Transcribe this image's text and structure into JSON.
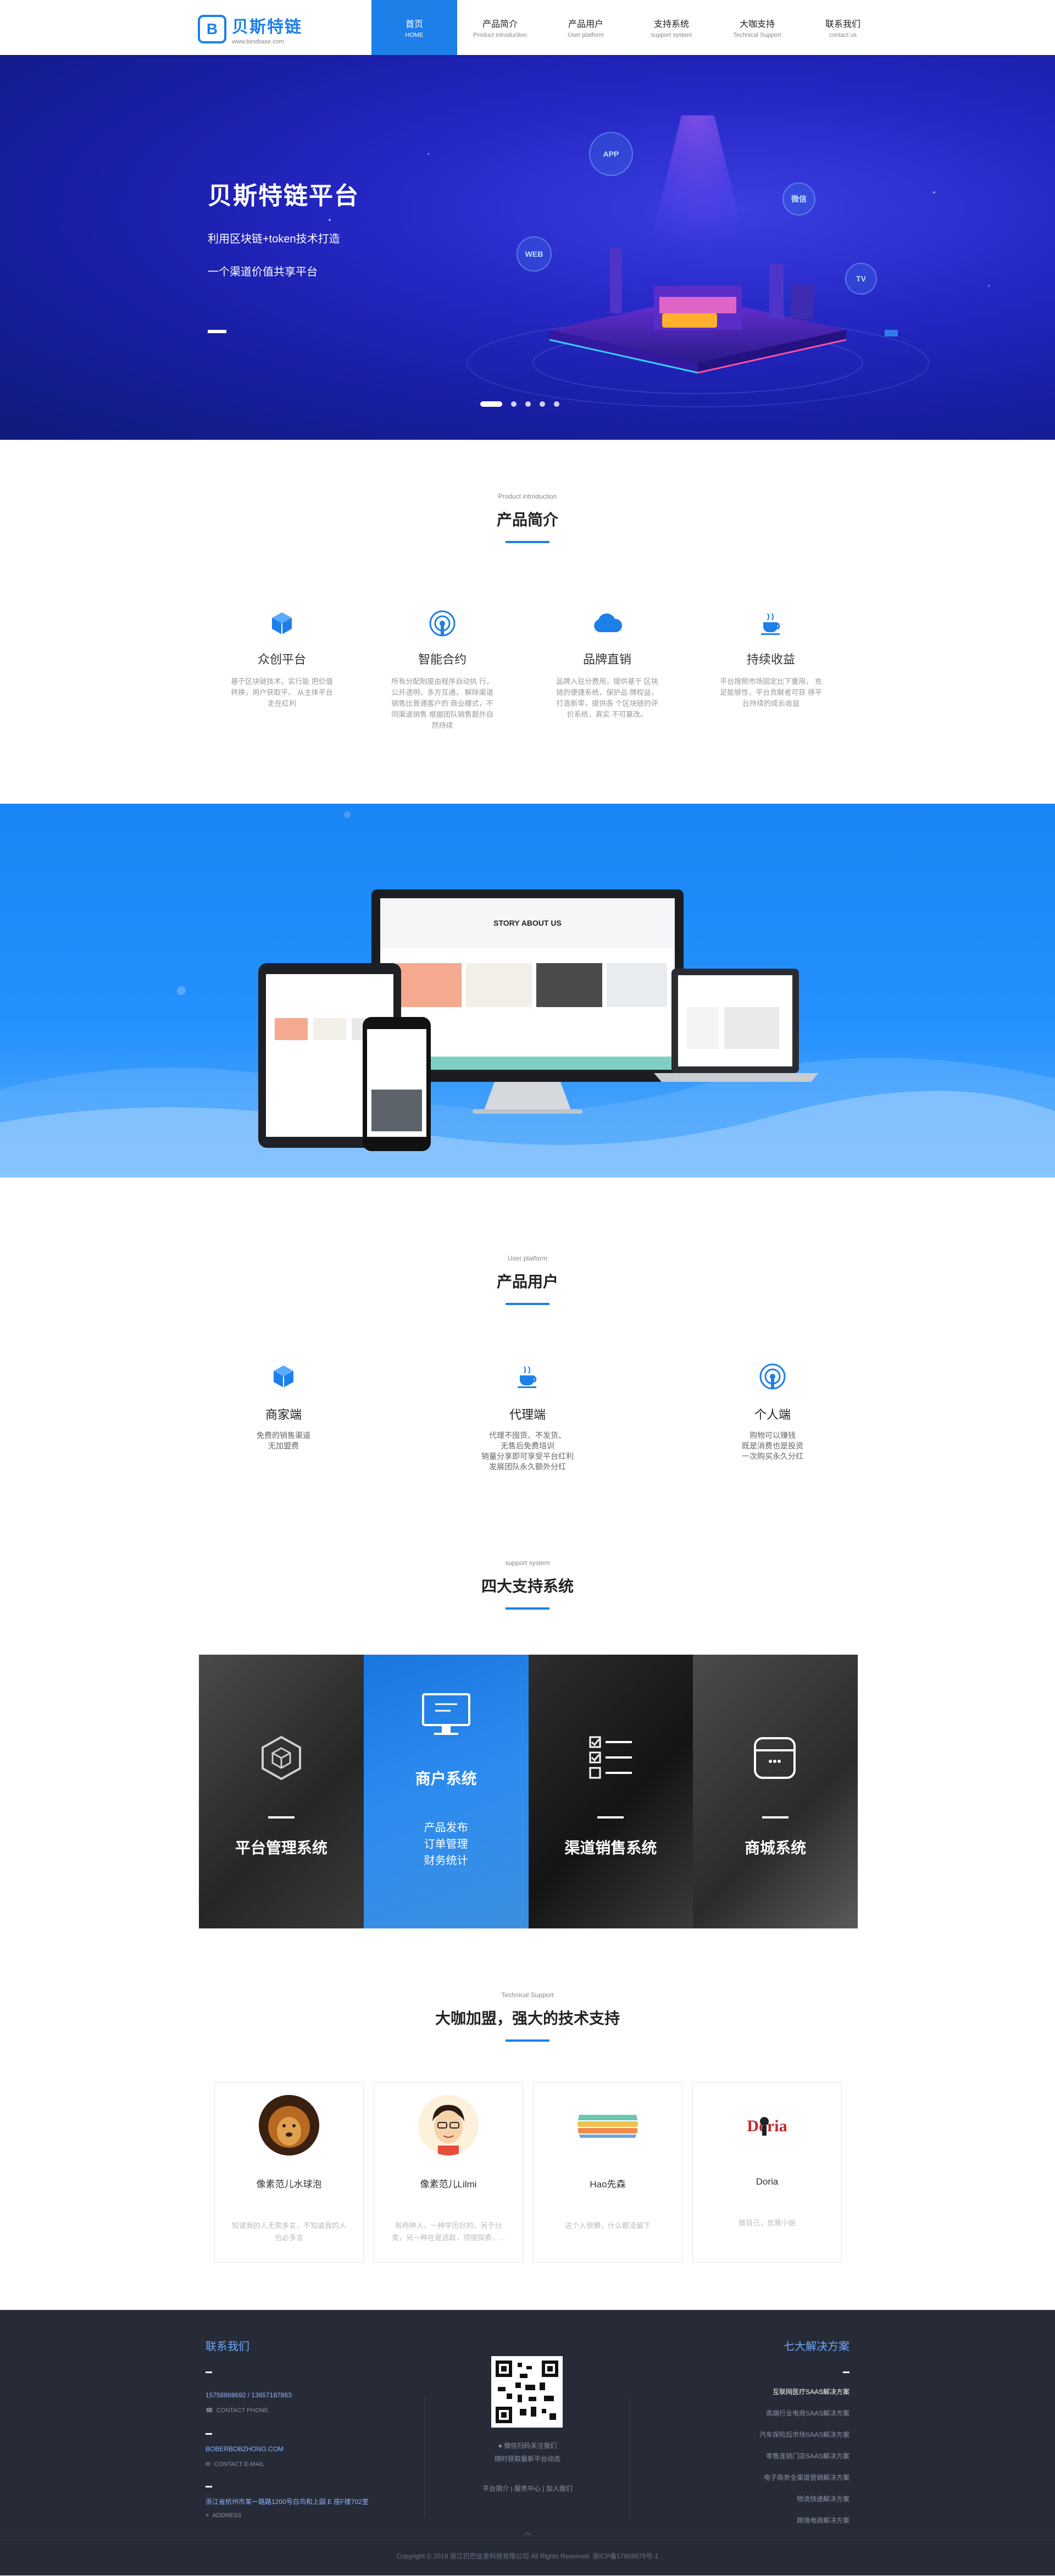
{
  "nav": {
    "logo_title": "贝斯特链",
    "logo_sub": "www.bestbase.com",
    "items": [
      {
        "zh": "首页",
        "en": "HOME"
      },
      {
        "zh": "产品简介",
        "en": "Product introduction"
      },
      {
        "zh": "产品用户",
        "en": "User platform"
      },
      {
        "zh": "支持系统",
        "en": "support system"
      },
      {
        "zh": "大咖支持",
        "en": "Technical Support"
      },
      {
        "zh": "联系我们",
        "en": "contact us"
      }
    ]
  },
  "hero": {
    "title": "贝斯特链平台",
    "line1": "利用区块链+token技术打造",
    "line2": "一个渠道价值共享平台",
    "bubbles": [
      "APP",
      "微信",
      "WEB",
      "TV"
    ]
  },
  "intro": {
    "en": "Product introduction",
    "zh": "产品简介",
    "items": [
      {
        "title": "众创平台",
        "desc": "基于区块链技术，实行能 把价值转换，用户获取平、 从主体平台走在红利",
        "icon": "cube-icon"
      },
      {
        "title": "智能合约",
        "desc": "所有分配制度由程序自动执 行，公开透明，多方互通， 解除渠道销售比普通客户的 商业模式，不同渠道销售 根据团队销售额外自然持续",
        "icon": "signal-icon"
      },
      {
        "title": "品牌直销",
        "desc": "品牌入驻分费用，提供基于 区块链的便捷系统，保护品 牌权益，打造新零，提供各 个区块链的评价系统，真实 不可篡改。",
        "icon": "cloud-icon"
      },
      {
        "title": "持续收益",
        "desc": "平台按照市场固定比下重用， 充足能够性，平台贡献者可获 得平台持续的成长收益",
        "icon": "coffee-icon"
      }
    ]
  },
  "users": {
    "en": "User platform",
    "zh": "产品用户",
    "items": [
      {
        "title": "商家端",
        "desc": "免费的销售渠道\n无加盟费",
        "icon": "cube-icon"
      },
      {
        "title": "代理端",
        "desc": "代理不囤货、不发货、\n无售后免费培训\n销量分享即可享受平台红利\n发展团队永久额外分红",
        "icon": "coffee-icon"
      },
      {
        "title": "个人端",
        "desc": "购物可以赚钱\n既是消费也是投资\n一次购买永久分红",
        "icon": "signal-icon"
      }
    ]
  },
  "support": {
    "en": "support system",
    "zh": "四大支持系统",
    "cols": [
      {
        "title": "平台管理系统",
        "icon": "hexagon-cube-icon"
      },
      {
        "title": "商户系统",
        "icon": "monitor-icon",
        "lines": [
          "产品发布",
          "订单管理",
          "财务统计"
        ]
      },
      {
        "title": "渠道销售系统",
        "icon": "checklist-icon"
      },
      {
        "title": "商城系统",
        "icon": "browser-window-icon"
      }
    ]
  },
  "tech": {
    "en": "Technical Support",
    "zh": "大咖加盟，强大的技术支持",
    "cards": [
      {
        "name": "像素范儿水球泡",
        "desc": "知道我的人无需多言，不知道我的人 也必多言"
      },
      {
        "name": "像素范儿Lilmi",
        "desc": "有两种人，一种学历好的，另于分 类，另一种在是选取，项提探索，..."
      },
      {
        "name": "Hao先森",
        "desc": "这个人很懒，什么都没留下"
      },
      {
        "name": "Doria",
        "desc": "做自己，优雅小姐"
      }
    ]
  },
  "footer": {
    "contact_title": "联系我们",
    "phone": "15756868692 / 13657187863",
    "phone_label": "CONTACT PHONE",
    "email": "BOBERBOBZHONG.COM",
    "email_label": "CONTACT E-MAIL",
    "address": "浙江省杭州市某一路路1200号白鸟和上园 E 座F楼702室",
    "address_label": "ADDRESS",
    "qr_line1": "微信扫码关注我们",
    "qr_line2": "随时获取最新平台动态",
    "links": "平台简介 | 服务中心 | 加入我们",
    "solutions_title": "七大解决方案",
    "solutions": [
      "互联网医疗SAAS解决方案",
      "高端行业电商SAAS解决方案",
      "汽车保险后市场SAAS解决方案",
      "零售连锁门店SAAS解决方案",
      "电子商务全渠道营销解决方案",
      "物流快递解决方案",
      "跨境电商解决方案"
    ],
    "copyright": "Copyright © 2019 浙江巴巴信息科技有限公司 All Rights Reserved.  浙ICP备17658679号-1"
  }
}
